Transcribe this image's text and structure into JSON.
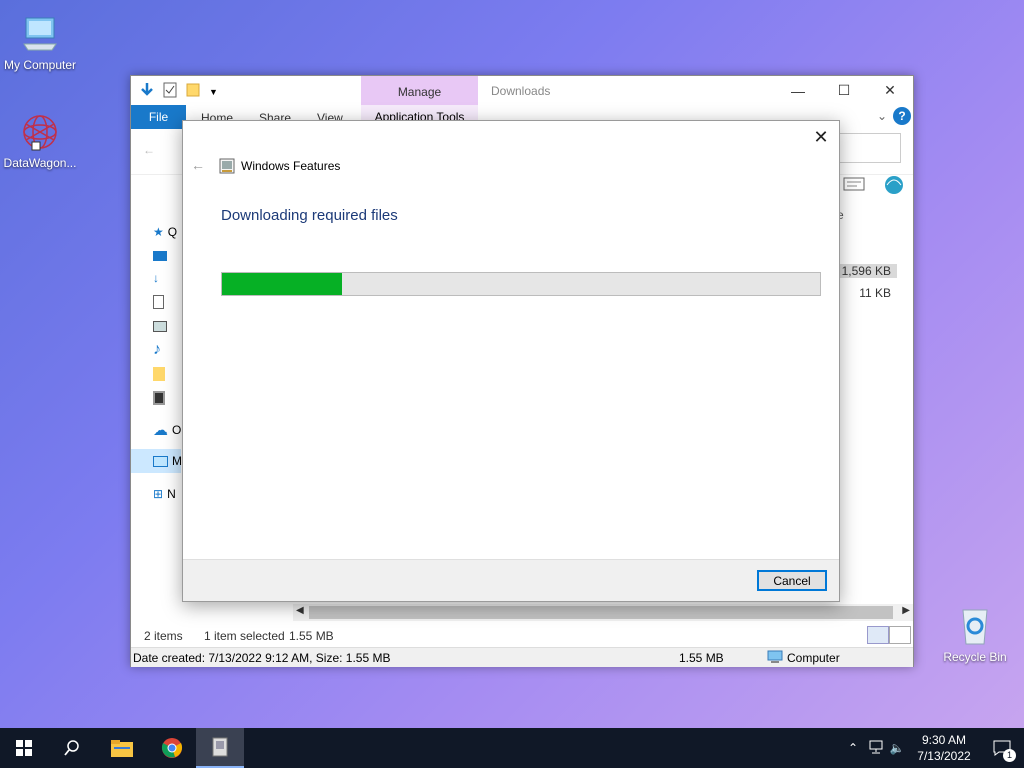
{
  "desktop": {
    "icons": [
      {
        "label": "My Computer",
        "icon": "computer-icon"
      },
      {
        "label": "DataWagon...",
        "icon": "datawagon-icon"
      },
      {
        "label": "Recycle Bin",
        "icon": "recycle-bin-icon"
      }
    ]
  },
  "explorer": {
    "manage_tab": "Manage",
    "window_title": "Downloads",
    "tabs": {
      "file": "File",
      "home": "Home",
      "share": "Share",
      "view": "View",
      "app_tools": "Application Tools"
    },
    "column_header": "ze",
    "files": [
      {
        "size": "1,596 KB"
      },
      {
        "size": "11 KB"
      }
    ],
    "nav_letters": [
      "Q",
      "O",
      "M",
      "N"
    ],
    "status": {
      "items": "2 items",
      "selected": "1 item selected",
      "selected_size": "1.55 MB"
    },
    "info": {
      "details": "Date created: 7/13/2022 9:12 AM, Size: 1.55 MB",
      "size": "1.55 MB",
      "location": "Computer"
    }
  },
  "dialog": {
    "app_title": "Windows Features",
    "heading": "Downloading required files",
    "progress": 0.2,
    "cancel_label": "Cancel"
  },
  "taskbar": {
    "time": "9:30 AM",
    "date": "7/13/2022",
    "notification_count": "1"
  },
  "colors": {
    "progress_fill": "#06b025",
    "file_tab": "#1979ca",
    "manage_tab": "#e8c8f5"
  }
}
